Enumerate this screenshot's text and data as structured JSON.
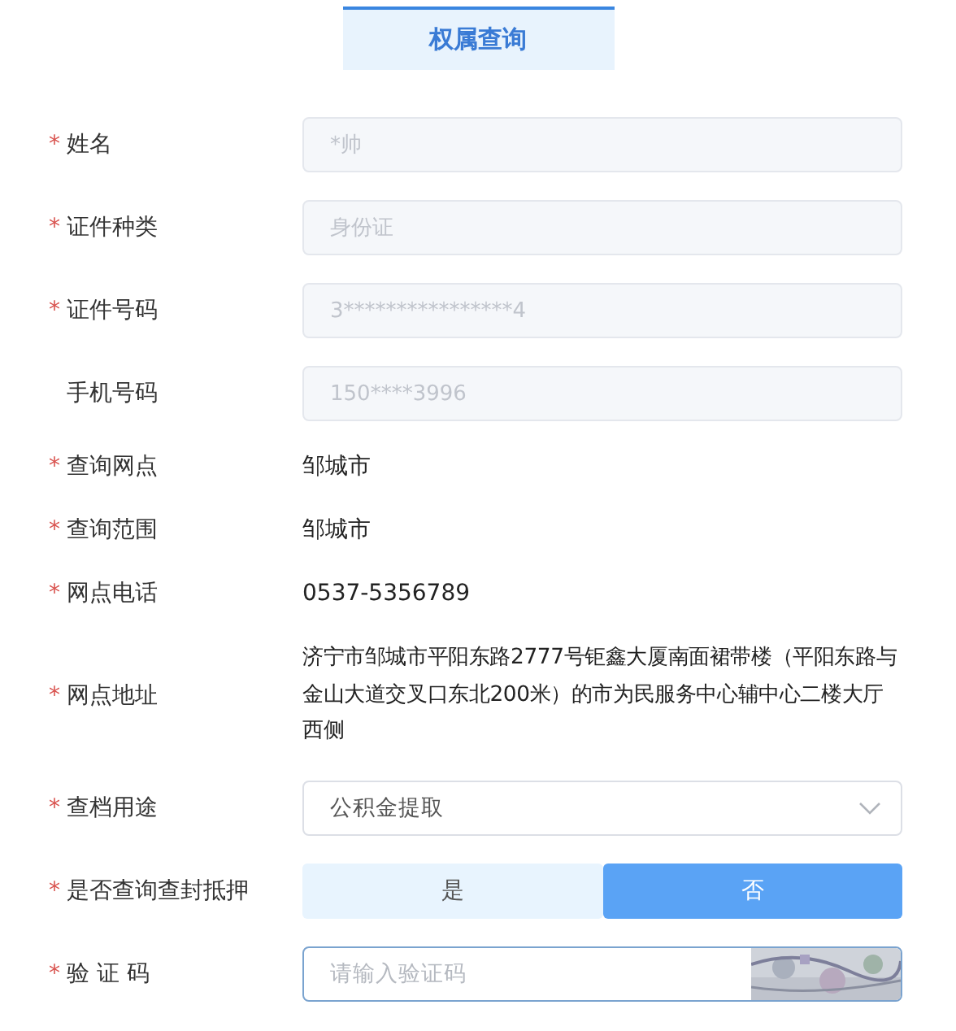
{
  "tab": {
    "label": "权属查询",
    "selected": true
  },
  "required_mark": "*",
  "fields": [
    {
      "kind": "input",
      "label": "姓名",
      "required": true,
      "value": "*帅",
      "disabled": true
    },
    {
      "kind": "input",
      "label": "证件种类",
      "required": true,
      "value": "身份证",
      "disabled": true
    },
    {
      "kind": "input",
      "label": "证件号码",
      "required": true,
      "value": "3****************4",
      "disabled": true
    },
    {
      "kind": "input",
      "label": "手机号码",
      "required": false,
      "value": "150****3996",
      "disabled": true
    },
    {
      "kind": "text",
      "label": "查询网点",
      "required": true,
      "value": "邹城市"
    },
    {
      "kind": "text",
      "label": "查询范围",
      "required": true,
      "value": "邹城市"
    },
    {
      "kind": "text",
      "label": "网点电话",
      "required": true,
      "value": "0537-5356789"
    },
    {
      "kind": "text",
      "label": "网点地址",
      "required": true,
      "value": "济宁市邹城市平阳东路2777号钜鑫大厦南面裙带楼（平阳东路与金山大道交叉口东北200米）的市为民服务中心辅中心二楼大厅西侧"
    },
    {
      "kind": "select",
      "label": "查档用途",
      "required": true,
      "value": "公积金提取"
    },
    {
      "kind": "toggle",
      "label": "是否查询查封抵押",
      "required": true,
      "options": [
        {
          "label": "是",
          "selected": false
        },
        {
          "label": "否",
          "selected": true
        }
      ]
    },
    {
      "kind": "captcha",
      "label": "验 证 码",
      "required": true,
      "placeholder": "请输入验证码",
      "focused": true
    }
  ]
}
